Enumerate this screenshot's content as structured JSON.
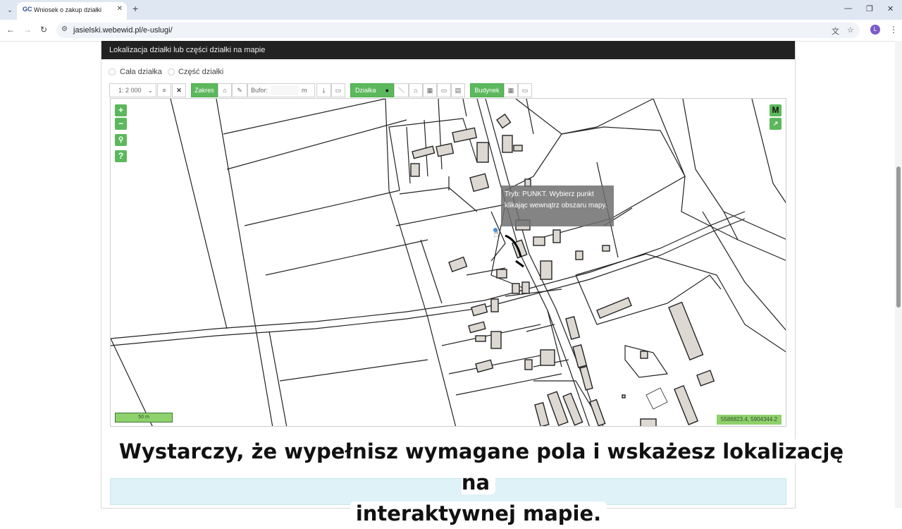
{
  "browser": {
    "tab_title": "Wniosek o zakup działki",
    "tab_favicon": "GC",
    "url": "jasielski.webewid.pl/e-uslugi/",
    "profile_initial": "L",
    "accent": "#7b5cc7"
  },
  "panel": {
    "title": "Lokalizacja działki lub części działki na mapie",
    "radio_whole": "Cała działka",
    "radio_part": "Część działki"
  },
  "toolbar": {
    "scale": "1: 2 000",
    "zakres": "Zakres",
    "bufor_label": "Bufor:",
    "bufor_value": "",
    "bufor_unit": "m",
    "dzialka": "Działka",
    "budynek": "Budynek"
  },
  "map": {
    "zoom_in": "+",
    "zoom_out": "−",
    "help": "?",
    "basemap": "M",
    "scalebar": "50 m",
    "coordinates": "5586823.4, 5904344.2",
    "tooltip": "Tryb: PUNKT. Wybierz punkt klikając wewnątrz obszaru mapy."
  },
  "caption": {
    "line1": "Wystarczy, że wypełnisz wymagane pola i wskażesz lokalizację na",
    "line2": "interaktywnej mapie."
  },
  "colors": {
    "green": "#5cb85c",
    "dark_header": "#222222",
    "input_bg": "#def2f8"
  }
}
